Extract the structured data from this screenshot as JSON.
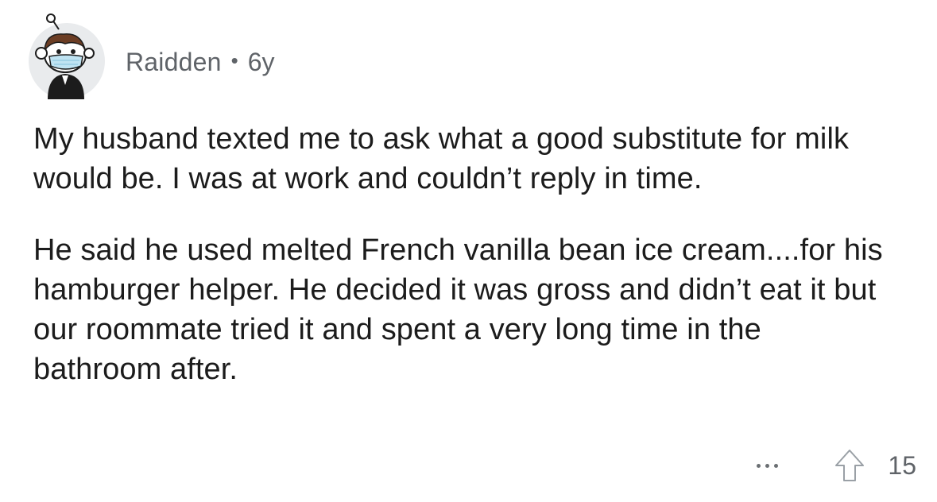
{
  "comment": {
    "author": "Raidden",
    "separator": "•",
    "age": "6y",
    "paragraphs": [
      "My husband texted me to ask what a good substitute for milk would be. I was at work and couldn’t reply in time.",
      "He said he used melted French vanilla bean ice cream....for his hamburger helper. He decided it was gross and didn’t eat it but our roommate tried it and spent a very long time in the bathroom after."
    ],
    "score": "15"
  },
  "icons": {
    "avatar": "snoo-avatar-icon",
    "more": "more-options-icon",
    "upvote": "upvote-arrow-icon"
  },
  "colors": {
    "text": "#1c1c1c",
    "meta": "#5f6368",
    "icon": "#6b6f73"
  }
}
